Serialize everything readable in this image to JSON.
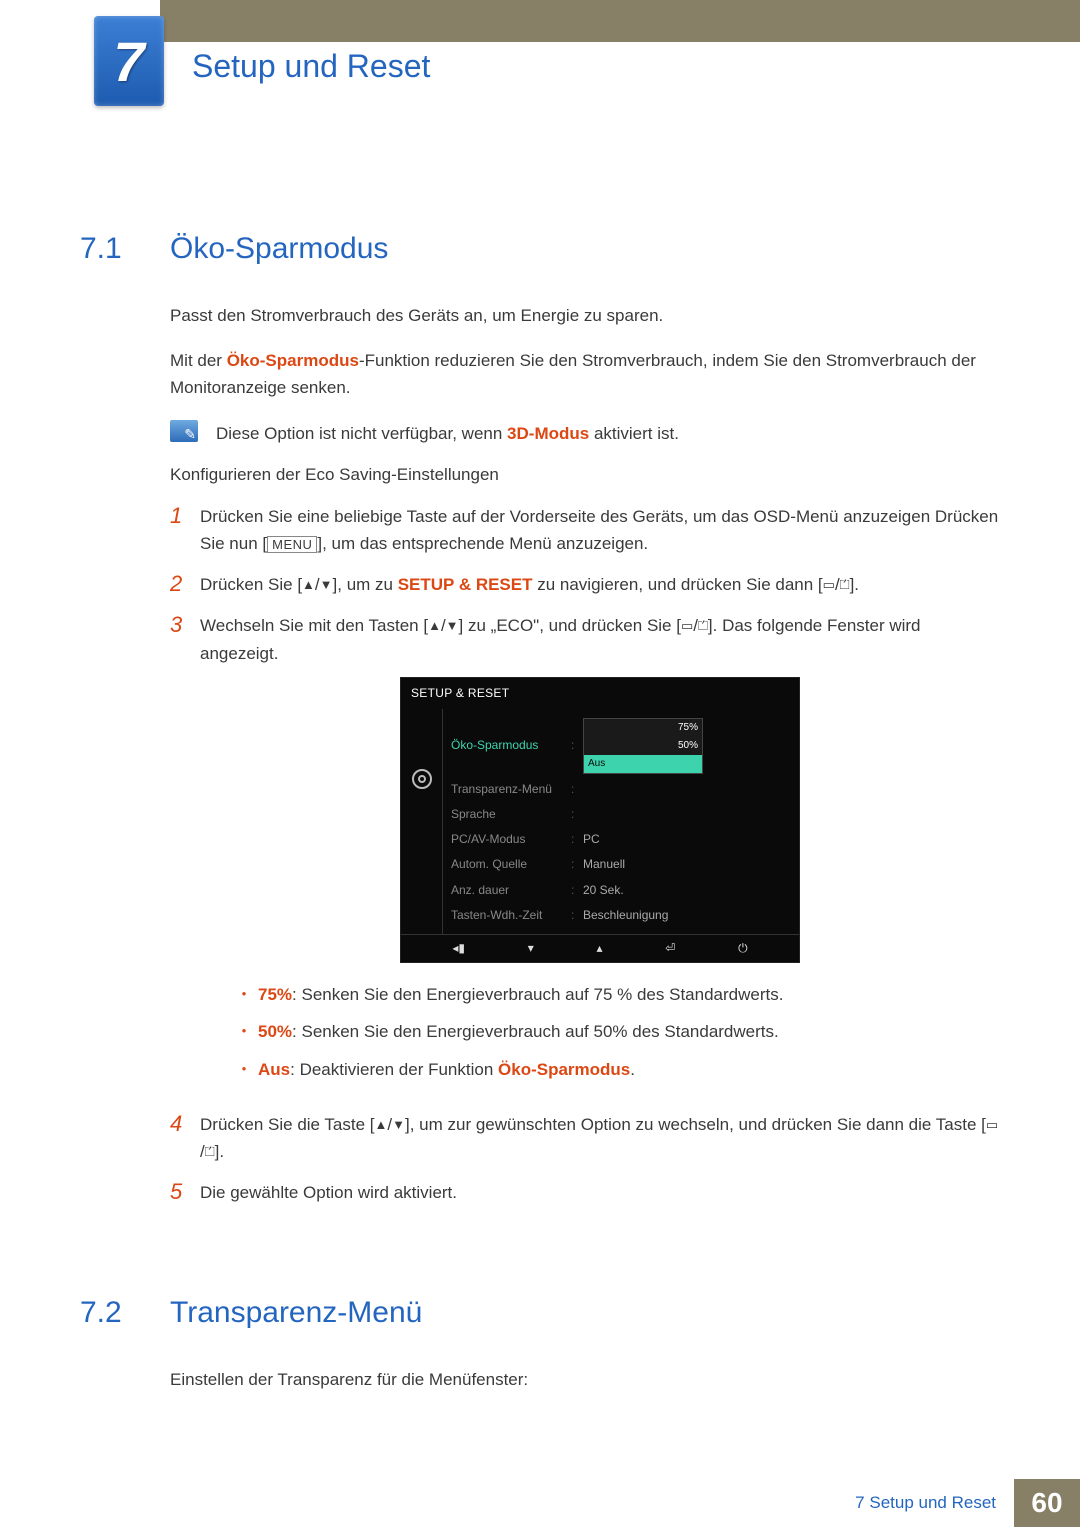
{
  "chapter": {
    "number": "7",
    "title": "Setup und Reset"
  },
  "section1": {
    "number": "7.1",
    "title": "Öko-Sparmodus",
    "p1": "Passt den Stromverbrauch des Geräts an, um Energie zu sparen.",
    "p2_pre": "Mit der ",
    "p2_bold": "Öko-Sparmodus",
    "p2_post": "-Funktion reduzieren Sie den Stromverbrauch, indem Sie den Stromverbrauch der Monitoranzeige senken.",
    "note_pre": "Diese Option ist nicht verfügbar, wenn ",
    "note_bold": "3D-Modus",
    "note_post": " aktiviert ist.",
    "subheading": "Konfigurieren der Eco Saving-Einstellungen",
    "step1_a": "Drücken Sie eine beliebige Taste auf der Vorderseite des Geräts, um das OSD-Menü anzuzeigen Drücken Sie nun [",
    "step1_menu": "MENU",
    "step1_b": "], um das entsprechende Menü anzuzeigen.",
    "step2_a": "Drücken Sie [",
    "step2_b": "], um zu ",
    "step2_bold": "SETUP & RESET",
    "step2_c": " zu navigieren, und drücken Sie dann [",
    "step2_d": "].",
    "step3_a": "Wechseln Sie mit den Tasten [",
    "step3_b": "] zu „ECO\", und drücken Sie [",
    "step3_c": "]. Das folgende Fenster wird angezeigt.",
    "bullet1_bold": "75%",
    "bullet1_text": ": Senken Sie den Energieverbrauch auf 75 % des Standardwerts.",
    "bullet2_bold": "50%",
    "bullet2_text": ": Senken Sie den Energieverbrauch auf 50% des Standardwerts.",
    "bullet3_bold": "Aus",
    "bullet3_text_a": ": Deaktivieren der Funktion ",
    "bullet3_text_bold": "Öko-Sparmodus",
    "bullet3_text_b": ".",
    "step4_a": "Drücken Sie die Taste [",
    "step4_b": "], um zur gewünschten Option zu wechseln, und drücken Sie dann die Taste [",
    "step4_c": "].",
    "step5": "Die gewählte Option wird aktiviert."
  },
  "osd": {
    "header": "SETUP & RESET",
    "rows": [
      {
        "label": "Öko-Sparmodus",
        "hl": true
      },
      {
        "label": "Transparenz-Menü",
        "val": ""
      },
      {
        "label": "Sprache",
        "val": ""
      },
      {
        "label": "PC/AV-Modus",
        "val": "PC"
      },
      {
        "label": "Autom. Quelle",
        "val": "Manuell"
      },
      {
        "label": "Anz. dauer",
        "val": "20 Sek."
      },
      {
        "label": "Tasten-Wdh.-Zeit",
        "val": "Beschleunigung"
      }
    ],
    "opt75": "75%",
    "opt50": "50%",
    "optAus": "Aus",
    "footer_icons": [
      "◂▮",
      "▾",
      "▴",
      "⏎",
      "⏻"
    ]
  },
  "section2": {
    "number": "7.2",
    "title": "Transparenz-Menü",
    "p1": "Einstellen der Transparenz für die Menüfenster:"
  },
  "footer": {
    "label": "7 Setup und Reset",
    "page": "60"
  },
  "step_numbers": {
    "n1": "1",
    "n2": "2",
    "n3": "3",
    "n4": "4",
    "n5": "5"
  },
  "glyphs": {
    "up": "▲",
    "down": "▼",
    "slash": "/",
    "rect": "▭",
    "eject": "⏍"
  }
}
